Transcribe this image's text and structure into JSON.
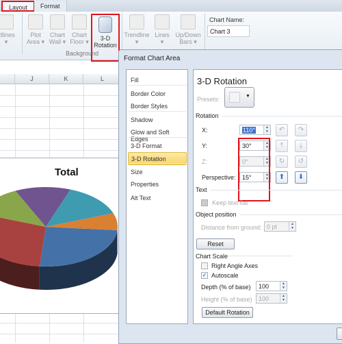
{
  "ribbon": {
    "tabs": [
      "Layout",
      "Format"
    ],
    "buttons": [
      {
        "label": "idlines",
        "sub": "▾"
      },
      {
        "label": "Plot",
        "sub": "Area ▾"
      },
      {
        "label": "Chart",
        "sub": "Wall ▾"
      },
      {
        "label": "Chart",
        "sub": "Floor ▾"
      },
      {
        "label": "3-D",
        "sub": "Rotation"
      },
      {
        "label": "Trendline",
        "sub": "▾"
      },
      {
        "label": "Lines",
        "sub": "▾"
      },
      {
        "label": "Up/Down",
        "sub": "Bars ▾"
      }
    ],
    "group_label": "Background",
    "chart_name_label": "Chart Name:",
    "chart_name_value": "Chart 3"
  },
  "sheet": {
    "columns": [
      "J",
      "K",
      "L"
    ]
  },
  "chart": {
    "title": "Total",
    "slice_colors": [
      "#4472a8",
      "#a84240",
      "#8aa64a",
      "#6f548f",
      "#3f9bb0",
      "#d98033"
    ]
  },
  "dialog": {
    "title": "Format Chart Area",
    "categories": [
      "Fill",
      "Border Color",
      "Border Styles",
      "Shadow",
      "Glow and Soft Edges",
      "3-D Format",
      "3-D Rotation",
      "Size",
      "Properties",
      "Alt Text"
    ],
    "selected": "3-D Rotation",
    "panel": {
      "title": "3-D Rotation",
      "presets_label": "Presets:",
      "rotation_label": "Rotation",
      "x_label": "X:",
      "x_value": "110°",
      "y_label": "Y:",
      "y_value": "30°",
      "z_label": "Z:",
      "z_value": "0°",
      "perspective_label": "Perspective:",
      "perspective_value": "15°",
      "text_label": "Text",
      "keep_text_flat": "Keep text flat",
      "keep_text_flat_checked": false,
      "object_position_label": "Object position",
      "distance_label": "Distance from ground:",
      "distance_value": "0 pt",
      "reset_label": "Reset",
      "chart_scale_label": "Chart Scale",
      "right_angle_axes": "Right Angle Axes",
      "right_angle_axes_checked": false,
      "autoscale": "Autoscale",
      "autoscale_checked": true,
      "depth_label": "Depth (% of base)",
      "depth_value": "100",
      "height_label": "Height (% of base)",
      "height_value": "100",
      "default_rotation_label": "Default Rotation"
    }
  },
  "colors": {
    "highlight": "#e0141b",
    "selection": "#f8d56a"
  }
}
